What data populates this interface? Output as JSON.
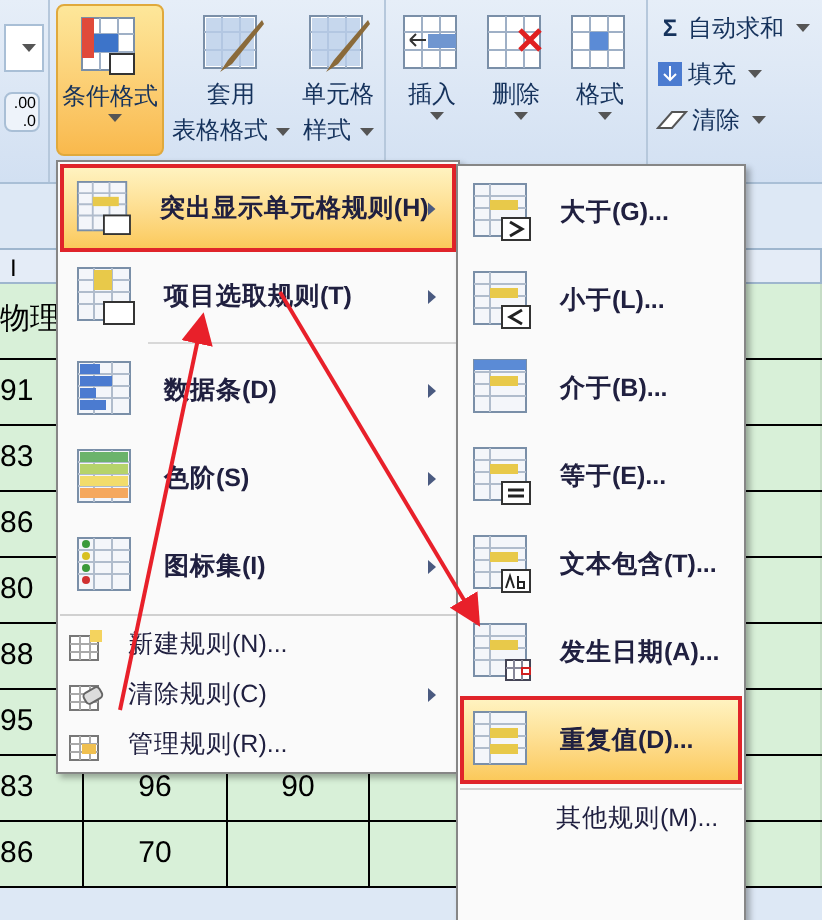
{
  "ribbon": {
    "left_partial": {
      "lines": [
        ".00",
        ".0"
      ]
    },
    "groups": [
      {
        "buttons": [
          {
            "lines": [
              "条件格式"
            ],
            "selected": true
          },
          {
            "lines": [
              "套用",
              "表格格式"
            ],
            "selected": false
          },
          {
            "lines": [
              "单元格",
              "样式"
            ],
            "selected": false
          }
        ]
      },
      {
        "buttons": [
          {
            "lines": [
              "插入"
            ],
            "selected": false
          },
          {
            "lines": [
              "删除"
            ],
            "selected": false
          },
          {
            "lines": [
              "格式"
            ],
            "selected": false
          }
        ]
      }
    ],
    "editing": [
      {
        "symbol": "Σ",
        "label": "自动求和"
      },
      {
        "label": "填充"
      },
      {
        "label": "清除"
      }
    ]
  },
  "sheet": {
    "column_header": "I",
    "rows": [
      [
        "物理"
      ],
      [
        "91"
      ],
      [
        "83"
      ],
      [
        "86"
      ],
      [
        "80"
      ],
      [
        "88"
      ],
      [
        "95"
      ],
      [
        "83",
        "96",
        "90"
      ],
      [
        "86",
        "70"
      ]
    ]
  },
  "menu": {
    "items": [
      {
        "label": "突出显示单元格规则(H)",
        "submenu": true,
        "selected": true
      },
      {
        "label": "项目选取规则(T)",
        "submenu": true,
        "selected": false
      },
      {
        "label": "数据条(D)",
        "submenu": true,
        "selected": false
      },
      {
        "label": "色阶(S)",
        "submenu": true,
        "selected": false
      },
      {
        "label": "图标集(I)",
        "submenu": true,
        "selected": false
      }
    ],
    "small_items": [
      {
        "label": "新建规则(N)...",
        "submenu": false
      },
      {
        "label": "清除规则(C)",
        "submenu": true
      },
      {
        "label": "管理规则(R)...",
        "submenu": false
      }
    ]
  },
  "submenu": {
    "items": [
      {
        "label": "大于(G)...",
        "selected": false
      },
      {
        "label": "小于(L)...",
        "selected": false
      },
      {
        "label": "介于(B)...",
        "selected": false
      },
      {
        "label": "等于(E)...",
        "selected": false
      },
      {
        "label": "文本包含(T)...",
        "selected": false
      },
      {
        "label": "发生日期(A)...",
        "selected": false
      },
      {
        "label": "重复值(D)...",
        "selected": true
      }
    ],
    "more": "其他规则(M)..."
  }
}
